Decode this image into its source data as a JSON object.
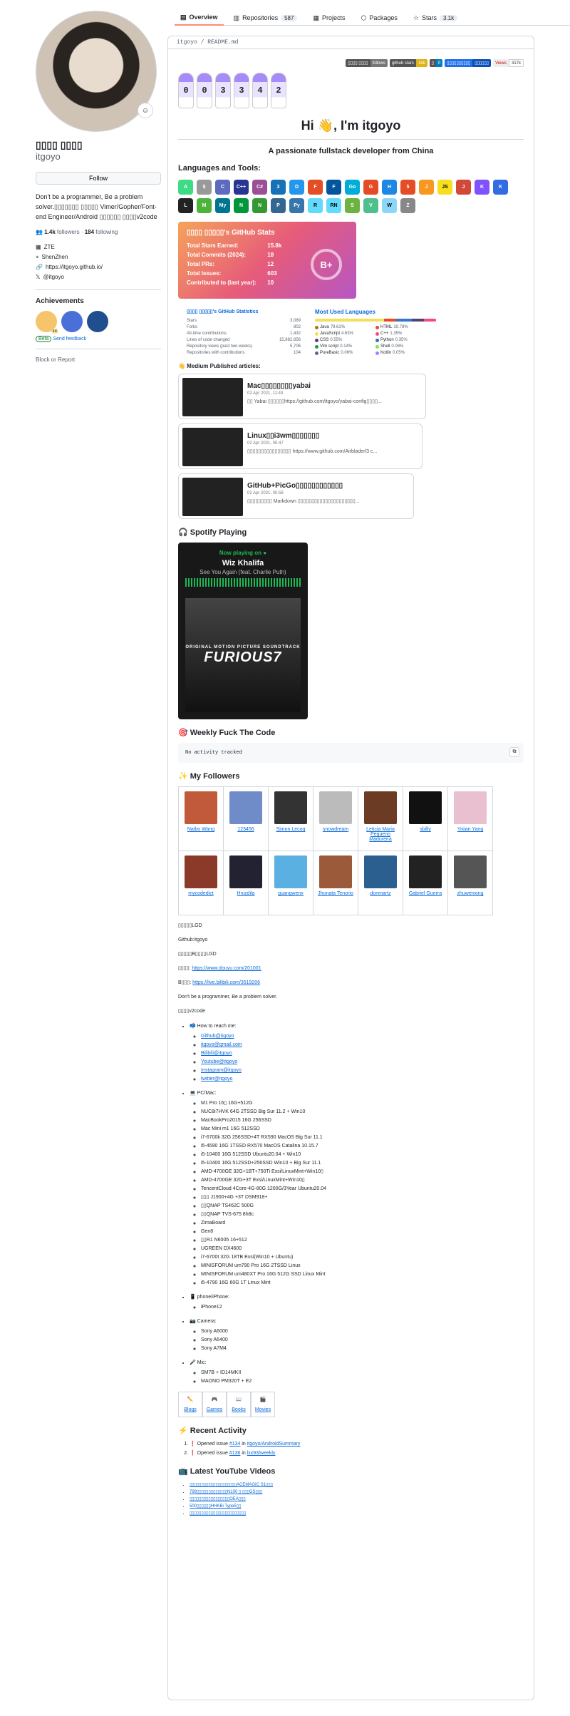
{
  "tabs": [
    {
      "label": "Overview",
      "icon": "book-icon"
    },
    {
      "label": "Repositories",
      "count": "587",
      "icon": "repo-icon"
    },
    {
      "label": "Projects",
      "icon": "table-icon"
    },
    {
      "label": "Packages",
      "icon": "package-icon"
    },
    {
      "label": "Stars",
      "count": "3.1k",
      "icon": "star-icon"
    }
  ],
  "profile": {
    "name": "▯▯▯▯ ▯▯▯▯",
    "login": "itgoyo",
    "follow": "Follow",
    "bio": "Don't be a programmer, Be a problem solver.▯▯▯▯▯▯▯ ▯▯▯▯▯ Vimer/Gopher/Font-end Engineer/Android ▯▯▯▯▯▯ ▯▯▯▯v2code",
    "followers": "1.4k",
    "followers_label": "followers",
    "following": "184",
    "following_label": "following",
    "company": "ZTE",
    "location": "ShenZhen",
    "website": "https://itgoyo.github.io/",
    "twitter": "@itgoyo",
    "achievements_title": "Achievements",
    "beta": "Beta",
    "feedback": "Send feedback",
    "block": "Block or Report",
    "ach_badge": "x4"
  },
  "readme": {
    "path": "itgoyo / README.md",
    "badges": [
      {
        "l": "▯▯▯▯ ▯▯▯▯",
        "r": "follows",
        "c": "#555"
      },
      {
        "l": "github stars",
        "r": "16k",
        "c": "#dfb317"
      },
      {
        "l": "▯",
        "r": "0",
        "c": "#007ec6"
      },
      {
        "l": "▯▯▯▯▯▯▯▯▯▯",
        "r": "▯▯▯▯▯▯",
        "c": "#1f6feb"
      },
      {
        "l": "Views",
        "r": "317k",
        "c": "#555"
      }
    ],
    "counter": [
      "0",
      "0",
      "3",
      "3",
      "4",
      "2"
    ],
    "hi": "Hi 👋, I'm itgoyo",
    "tagline": "A passionate fullstack developer from China",
    "lang_tools": "Languages and Tools:",
    "stats_card": {
      "title": "▯▯▯▯ ▯▯▯▯▯'s GitHub Stats",
      "rows": [
        {
          "k": "Total Stars Earned:",
          "v": "15.8k"
        },
        {
          "k": "Total Commits (2024):",
          "v": "18"
        },
        {
          "k": "Total PRs:",
          "v": "12"
        },
        {
          "k": "Total Issues:",
          "v": "603"
        },
        {
          "k": "Contributed to (last year):",
          "v": "10"
        }
      ],
      "grade": "B+"
    },
    "gh_stats": {
      "title": "▯▯▯▯ ▯▯▯▯▯'s GitHub Statistics",
      "rows": [
        {
          "k": "Stars",
          "v": "3,089"
        },
        {
          "k": "Forks",
          "v": "802"
        },
        {
          "k": "All-time contributions",
          "v": "1,432"
        },
        {
          "k": "Lines of code changed",
          "v": "15,882,656"
        },
        {
          "k": "Repository views (past two weeks)",
          "v": "5,706"
        },
        {
          "k": "Repositories with contributions",
          "v": "104"
        }
      ]
    },
    "languages": {
      "title": "Most Used Languages",
      "items": [
        {
          "n": "Java",
          "p": "79.61%",
          "c": "#b07219"
        },
        {
          "n": "HTML",
          "p": "10.78%",
          "c": "#e34c26"
        },
        {
          "n": "JavaScript",
          "p": "4.63%",
          "c": "#f1e05a"
        },
        {
          "n": "C++",
          "p": "1.35%",
          "c": "#f34b7d"
        },
        {
          "n": "CSS",
          "p": "0.55%",
          "c": "#563d7c"
        },
        {
          "n": "Python",
          "p": "0.35%",
          "c": "#3572A5"
        },
        {
          "n": "Vim script",
          "p": "0.14%",
          "c": "#199f4b"
        },
        {
          "n": "Shell",
          "p": "0.08%",
          "c": "#89e051"
        },
        {
          "n": "PureBasic",
          "p": "0.06%",
          "c": "#5a6986"
        },
        {
          "n": "Kotlin",
          "p": "0.05%",
          "c": "#A97BFF"
        }
      ]
    },
    "medium_title": "👋 Medium Published articles:",
    "articles": [
      {
        "t": "Mac▯▯▯▯▯▯▯▯yabai",
        "d": "02 Apr 2021, 11:43",
        "s": "▯▯ Yabai ▯▯▯▯▯▯https://github.com/itgoyo/yabai-config▯▯▯▯..."
      },
      {
        "t": "Linux▯▯i3wm▯▯▯▯▯▯▯",
        "d": "02 Apr 2021, 05:47",
        "s": "▯▯▯▯▯▯▯▯▯▯▯▯▯▯▯▯ https://www.github.com/Airbladerl3 c..."
      },
      {
        "t": "GitHub+PicGo▯▯▯▯▯▯▯▯▯▯▯▯",
        "d": "02 Apr 2021, 05:58",
        "s": "▯▯▯▯▯▯▯▯▯ Markdown ▯▯▯▯▯▯▯▯▯▯▯▯▯▯▯▯▯▯▯▯▯..."
      }
    ],
    "spotify_title": "🎧 Spotify Playing",
    "spotify": {
      "now": "Now playing on",
      "artist": "Wiz Khalifa",
      "song": "See You Again (feat. Charlie Puth)",
      "album": "FURIOUS7",
      "album_sub": "ORIGINAL MOTION PICTURE SOUNDTRACK"
    },
    "weekly_title": "🎯 Weekly Fuck The Code",
    "weekly_code": "No activity tracked",
    "followers_title": "✨ My Followers",
    "followers": [
      [
        {
          "n": "Naibo Wang",
          "c": "#c05a3a"
        },
        {
          "n": "123456",
          "c": "#6f8cc9"
        },
        {
          "n": "Simon Lecoq",
          "c": "#333"
        },
        {
          "n": "snowdream",
          "c": "#bbb"
        },
        {
          "n": "Leticia Maria Pequeno Madureira",
          "c": "#6b3b24"
        },
        {
          "n": "sbilly",
          "c": "#111"
        },
        {
          "n": "Yixian Yang",
          "c": "#e8c0d0"
        }
      ],
      [
        {
          "n": "mycodedict",
          "c": "#8b3a2a"
        },
        {
          "n": "Hnizdila",
          "c": "#223"
        },
        {
          "n": "guangwenx",
          "c": "#5ab0e0"
        },
        {
          "n": "Jhonata Tenorio",
          "c": "#9b5a3a"
        },
        {
          "n": "donmartz",
          "c": "#2a5f8f"
        },
        {
          "n": "Gabriel Guerra",
          "c": "#222"
        },
        {
          "n": "zhuwenxing",
          "c": "#555"
        }
      ]
    ],
    "plain": [
      "▯▯▯▯▯LGD",
      "Github:itgoyo",
      "▯▯▯▯▯B▯▯▯▯LGD"
    ],
    "douyu_label": "▯▯▯▯",
    "douyu": "https://www.douyu.com/201001",
    "bili_label": "B▯▯▯",
    "bili": "https://live.bilibili.com/3519206",
    "motto": "Don't be a programmer, Be a problem solver.",
    "v2": "▯▯▯▯v2code",
    "reach_title": "📫 How to reach me:",
    "reach": [
      "Github@itgoyo",
      "itgoyo@gmail.com",
      "Bilibili@itgoyo",
      "Youtube@itgoyo",
      "Instagram@itgoyo",
      "twitter@itgoyo"
    ],
    "pc_title": "💻 PC/Mac:",
    "pc": [
      "M1 Pro 16▯ 16G+512G",
      "NUC8i7HVK 64G 2TSSD Big Sur 11.2 + Win10",
      "MacBookPro2015 16G 256SSD",
      "Mac Mini m1 16G 512SSD",
      "i7-6700k 32G 256SSD+4T RX590 MacOS Big Sur 11.1",
      "i5-4590 16G 1TSSD RX570 MacOS Catalina 10.15.7",
      "i5-10400 16G 512SSD Ubuntu20.04 + Win10",
      "i5-10400 16G 512SSD+256SSD Win10 + Big Sur 11.1",
      "AMD-4700GE 32G+1BT+750Ti Exsi/LinuxMint+Win10▯",
      "AMD-4700GE 32G+3T Exsi/LinuxMint+Win10▯",
      "TencentCloud 4Core-4G-80G 1200G/3Year Ubuntu20.04",
      "▯▯▯ J1900+4G +3T DSM918+",
      "▯▯QNAP TS462C 500G",
      "▯▯QNAP TVS-675 8h8c",
      "ZimaBoard",
      "Gen8",
      "▯▯R1 N6005 16+512",
      "UGREEN DX4600",
      "i7-6700t 32G 18TB Exsi(Win10 + Ubuntu)",
      "MINISFORUM um790 Pro 16G 2TSSD Linux",
      "MINISFORUM um480XT Pro 16G 512G SSD Linux Mint",
      "i5-4790 16G 60G 1T Linux Mint"
    ],
    "phone_title": "📱 phone/iPhone:",
    "phone": [
      "iPhone12"
    ],
    "camera_title": "📷 Camera:",
    "camera": [
      "Sony A6000",
      "Sony A6400",
      "Sony A7M4"
    ],
    "mic_title": "🎤 Mic:",
    "mic": [
      "SM7B + ID14MKII",
      "MAONO PM320T + E2"
    ],
    "nav": [
      {
        "i": "✏️",
        "l": "Blogs"
      },
      {
        "i": "🎮",
        "l": "Games"
      },
      {
        "i": "📖",
        "l": "Books"
      },
      {
        "i": "🎬",
        "l": "Movies"
      }
    ],
    "activity_title": "⚡ Recent Activity",
    "activity": [
      {
        "pre": "❗ Opened issue ",
        "num": "#134",
        "mid": " in ",
        "repo": "itgoyo/AndroidSummary"
      },
      {
        "pre": "❗ Opened issue ",
        "num": "#136",
        "mid": " in ",
        "repo": "lxx93/weekly"
      }
    ],
    "yt_title": "📺 Latest YouTube Videos",
    "yt": [
      "▯▯▯▯▯▯▯▯▯▯▯▯▯▯▯▯▯▯▯▯ACEMAGIC S1▯▯▯",
      "799▯▯▯▯▯▯▯▯▯▯▯▯▯N100 ▯ ▯▯▯GS▯▯▯",
      "▯▯▯▯▯▯▯▯▯▯▯▯▯▯▯▯▯OEA▯▯▯",
      "500▯▯▯▯▯▯HHKBi Type5▯▯",
      "▯▯▯▯▯▯▯▯▯▯▯▯▯▯▯▯▯▯▯▯▯▯▯▯"
    ]
  }
}
